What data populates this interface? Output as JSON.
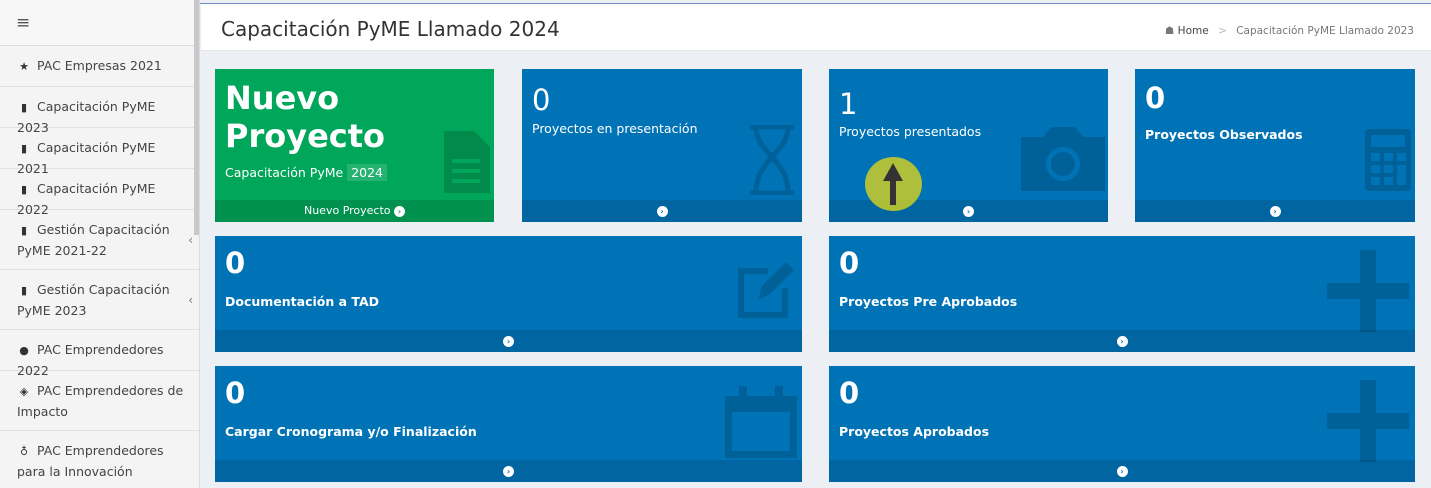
{
  "sidebar": {
    "toggle_icon": "bars-icon",
    "items": [
      {
        "icon": "star-icon",
        "label": "PAC Empresas 2021"
      },
      {
        "icon": "book-icon",
        "label": "Capacitación PyME 2023"
      },
      {
        "icon": "book-icon",
        "label": "Capacitación PyME 2021"
      },
      {
        "icon": "book-icon",
        "label": "Capacitación PyME 2022"
      },
      {
        "icon": "book-icon",
        "label": "Gestión Capacitación PyME 2021-22"
      },
      {
        "icon": "book-icon",
        "label": "Gestión Capacitación PyME 2023"
      },
      {
        "icon": "check-circle-icon",
        "label": "PAC Emprendedores 2022"
      },
      {
        "icon": "eye-icon",
        "label": "PAC Emprendedores de Impacto"
      },
      {
        "icon": "lightbulb-icon",
        "label": "PAC Emprendedores para la Innovación"
      }
    ]
  },
  "header": {
    "title": "Capacitación PyME Llamado 2024",
    "breadcrumb": {
      "home": "Home",
      "current": "Capacitación PyME Llamado 2023"
    }
  },
  "cards": {
    "nuevo": {
      "title_line1": "Nuevo",
      "title_line2": "Proyecto",
      "sub_prefix": "Capacitación PyMe",
      "sub_year": "2024",
      "footer": "Nuevo Proyecto"
    },
    "presentacion": {
      "count": "0",
      "label": "Proyectos en presentación"
    },
    "presentados": {
      "count": "1",
      "label": "Proyectos presentados"
    },
    "observados": {
      "count": "0",
      "label": "Proyectos Observados"
    },
    "tad": {
      "count": "0",
      "label": "Documentación a TAD"
    },
    "pre_aprobados": {
      "count": "0",
      "label": "Proyectos Pre Aprobados"
    },
    "cronograma": {
      "count": "0",
      "label": "Cargar Cronograma y/o Finalización"
    },
    "aprobados": {
      "count": "0",
      "label": "Proyectos Aprobados"
    }
  },
  "colors": {
    "primary": "#0073b7",
    "success": "#00a65a",
    "cursor": "#cccc26"
  }
}
